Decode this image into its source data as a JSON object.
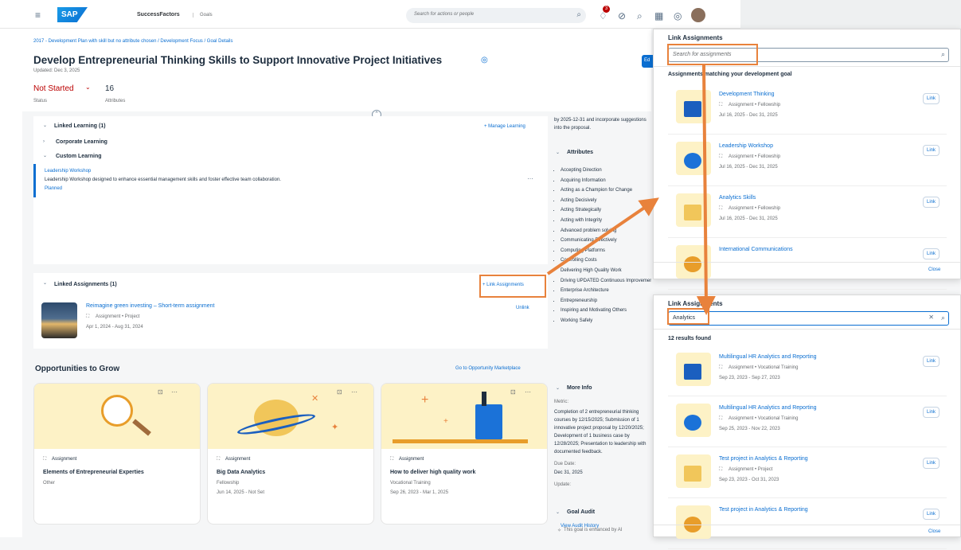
{
  "shell": {
    "product": "SuccessFactors",
    "module": "Goals",
    "search_placeholder": "Search for actions or people",
    "badge": "3",
    "logo_text": "SAP"
  },
  "page": {
    "breadcrumb": "2017 - Development Plan with skill but no attribute chosen / Development Focus / Goal Details",
    "title": "Develop Entrepreneurial Thinking Skills to Support Innovative Project Initiatives",
    "updated": "Updated: Dec 3, 2025",
    "status_value": "Not Started",
    "status_label": "Status",
    "attributes_count": "16",
    "attributes_label": "Attributes",
    "edit_label": "Ed"
  },
  "linked_learning": {
    "title": "Linked Learning (1)",
    "manage": "+ Manage Learning",
    "corporate": "Corporate Learning",
    "custom": "Custom Learning",
    "item_title": "Leadership Workshop",
    "item_desc": "Leadership Workshop designed to enhance essential management skills and foster effective team collaboration.",
    "item_status": "Planned",
    "more": "…"
  },
  "linked_assignments": {
    "title": "Linked Assignments (1)",
    "link_button": "+ Link Assignments",
    "item_title": "Reimagine green investing – Short-term assignment",
    "item_type": "Assignment • Project",
    "item_dates": "Apr 1, 2024 - Aug 31, 2024",
    "unlink": "Unlink"
  },
  "opportunities": {
    "title": "Opportunities to Grow",
    "goto": "Go to Opportunity Marketplace",
    "cards": [
      {
        "type": "Assignment",
        "title": "Elements of Entrepreneurial Experties",
        "sub": "Other",
        "dates": ""
      },
      {
        "type": "Assignment",
        "title": "Big Data Analytics",
        "sub": "Fellowship",
        "dates": "Jun 14, 2025 - Not Set"
      },
      {
        "type": "Assignment",
        "title": "How to deliver high quality work",
        "sub": "Vocational Training",
        "dates": "Sep 26, 2023 - Mar 1, 2025"
      }
    ]
  },
  "right_column": {
    "intro": "by 2025-12-31 and incorporate suggestions into the proposal.",
    "attributes_title": "Attributes",
    "attributes": [
      "Accepting Direction",
      "Acquiring Information",
      "Acting as a Champion for Change",
      "Acting Decisively",
      "Acting Strategically",
      "Acting with Integrity",
      "Advanced problem solving",
      "Communicating Effectively",
      "Computing Platforms",
      "Controlling Costs",
      "Delivering High Quality Work",
      "Driving UPDATED Continuous Improvement",
      "Enterprise Architecture",
      "Entrepreneurship",
      "Inspiring and Motivating Others",
      "Working Safely"
    ],
    "more_info_title": "More Info",
    "metric_label": "Metric:",
    "metric_text": "Completion of 2 entrepreneurial thinking courses by 12/15/2025; Submission of 1 innovative project proposal by 12/20/2025; Development of 1 business case by 12/28/2025; Presentation to leadership with documented feedback.",
    "due_label": "Due Date:",
    "due_value": "Dec 31, 2025",
    "update_label": "Update:",
    "goal_audit_title": "Goal Audit",
    "view_audit": "View Audit History",
    "ai_note": "This goal is enhanced by AI"
  },
  "dialog1": {
    "title": "Link Assignments",
    "placeholder": "Search for assignments",
    "section": "Assignments matching your development goal",
    "items": [
      {
        "title": "Development Thinking",
        "type": "Assignment • Fellowship",
        "dates": "Jul 16, 2025 - Dec 31, 2025",
        "action": "Link"
      },
      {
        "title": "Leadership Workshop",
        "type": "Assignment • Fellowship",
        "dates": "Jul 16, 2025 - Dec 31, 2025",
        "action": "Link"
      },
      {
        "title": "Analytics Skills",
        "type": "Assignment • Fellowship",
        "dates": "Jul 16, 2025 - Dec 31, 2025",
        "action": "Link"
      },
      {
        "title": "International Communications",
        "type": "",
        "dates": "",
        "action": "Link"
      }
    ],
    "close": "Close"
  },
  "dialog2": {
    "title": "Link Assignments",
    "search_value": "Analytics",
    "results": "12 results found",
    "items": [
      {
        "title": "Multilingual HR Analytics and Reporting",
        "type": "Assignment • Vocational Training",
        "dates": "Sep 23, 2023 - Sep 27, 2023",
        "action": "Link"
      },
      {
        "title": "Multilingual HR Analytics and Reporting",
        "type": "Assignment • Vocational Training",
        "dates": "Sep 25, 2023 - Nov 22, 2023",
        "action": "Link"
      },
      {
        "title": "Test project in Analytics & Reporting",
        "type": "Assignment • Project",
        "dates": "Sep 23, 2023 - Oct 31, 2023",
        "action": "Link"
      },
      {
        "title": "Test project in Analytics & Reporting",
        "type": "",
        "dates": "",
        "action": "Link"
      }
    ],
    "close": "Close"
  },
  "colors": {
    "accent": "#0a6ed1",
    "annotation": "#e8823c",
    "status": "#bb0000",
    "illustration": "#fdf2c6"
  }
}
